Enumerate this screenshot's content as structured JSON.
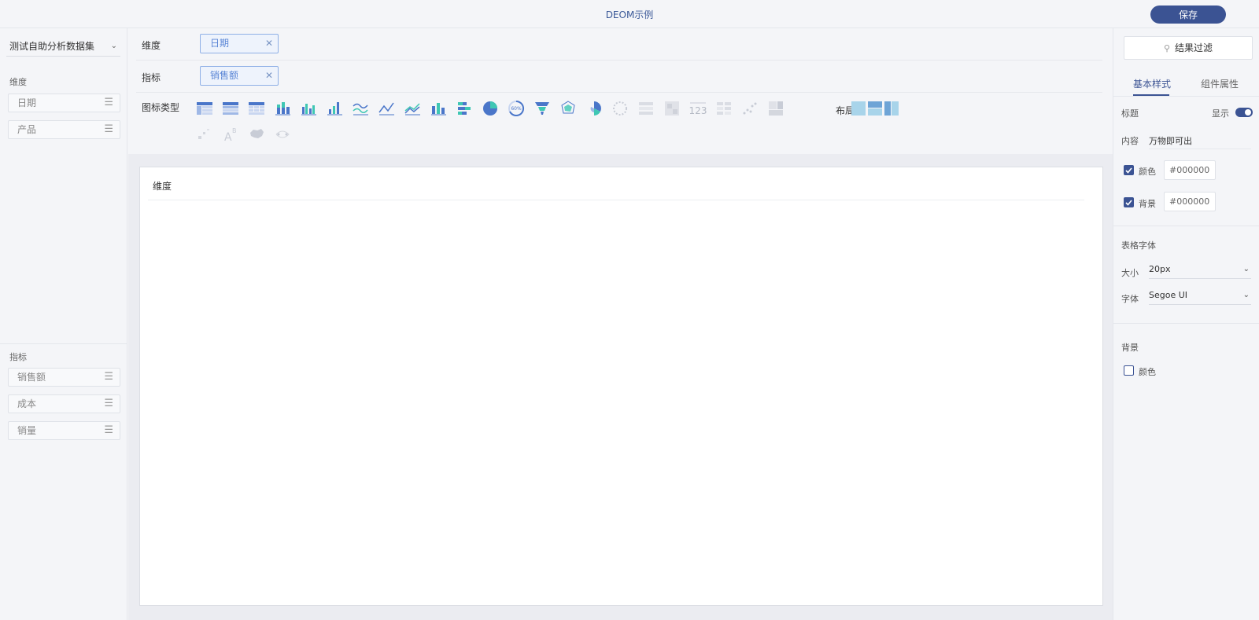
{
  "app": {
    "title": "DEOM示例",
    "save_label": "保存"
  },
  "left": {
    "dataset": "测试自助分析数据集",
    "dimensions_label": "维度",
    "dimensions": [
      "日期",
      "产品"
    ],
    "measures_label": "指标",
    "measures": [
      "销售额",
      "成本",
      "销量"
    ]
  },
  "config": {
    "dimension_label": "维度",
    "dimension_tag": "日期",
    "measure_label": "指标",
    "measure_tag": "销售额",
    "chart_type_label": "图标类型",
    "layout_label": "布局",
    "gauge_text": "60%",
    "number_text": "123"
  },
  "canvas": {
    "title": "维度"
  },
  "right": {
    "filter_label": "结果过滤",
    "tabs": [
      "基本样式",
      "组件属性"
    ],
    "title_label": "标题",
    "show_label": "显示",
    "content_label": "内容",
    "content_value": "万物即可出",
    "color_label": "颜色",
    "color_value": "#000000",
    "bg_label": "背景",
    "bg_value": "#000000",
    "table_font_label": "表格字体",
    "size_label": "大小",
    "size_value": "20px",
    "font_label": "字体",
    "font_value": "Segoe UI",
    "background_section": "背景",
    "background_color_label": "颜色"
  },
  "colors": {
    "accent": "#3b5393",
    "tag_border": "#8fb0e6",
    "chart_blue": "#4a76c9",
    "chart_teal": "#3fc7b4"
  }
}
